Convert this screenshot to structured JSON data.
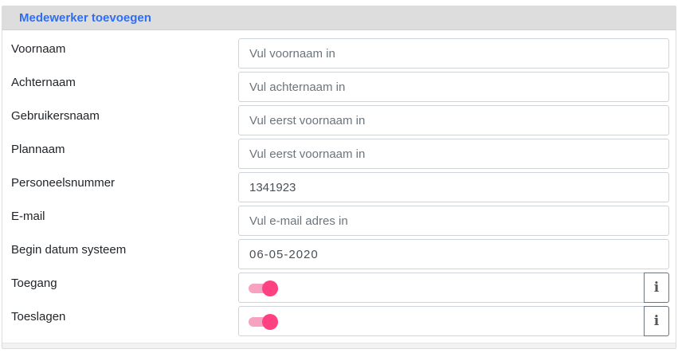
{
  "panel": {
    "title": "Medewerker toevoegen"
  },
  "fields": {
    "voornaam": {
      "label": "Voornaam",
      "value": "",
      "placeholder": "Vul voornaam in"
    },
    "achternaam": {
      "label": "Achternaam",
      "value": "",
      "placeholder": "Vul achternaam in"
    },
    "gebruikersnaam": {
      "label": "Gebruikersnaam",
      "value": "",
      "placeholder": "Vul eerst voornaam in"
    },
    "plannaam": {
      "label": "Plannaam",
      "value": "",
      "placeholder": "Vul eerst voornaam in"
    },
    "personeelsnummer": {
      "label": "Personeelsnummer",
      "value": "1341923",
      "placeholder": ""
    },
    "email": {
      "label": "E-mail",
      "value": "",
      "placeholder": "Vul e-mail adres in"
    },
    "begin_datum": {
      "label": "Begin datum systeem",
      "value": "06-05-2020",
      "placeholder": ""
    }
  },
  "toggles": {
    "toegang": {
      "label": "Toegang",
      "checked": true,
      "info_icon": "info-icon"
    },
    "toeslagen": {
      "label": "Toeslagen",
      "checked": true,
      "info_icon": "info-icon"
    }
  },
  "colors": {
    "title": "#2f6df1",
    "switch_thumb": "#ff4081",
    "switch_track": "#f7a2c1"
  }
}
